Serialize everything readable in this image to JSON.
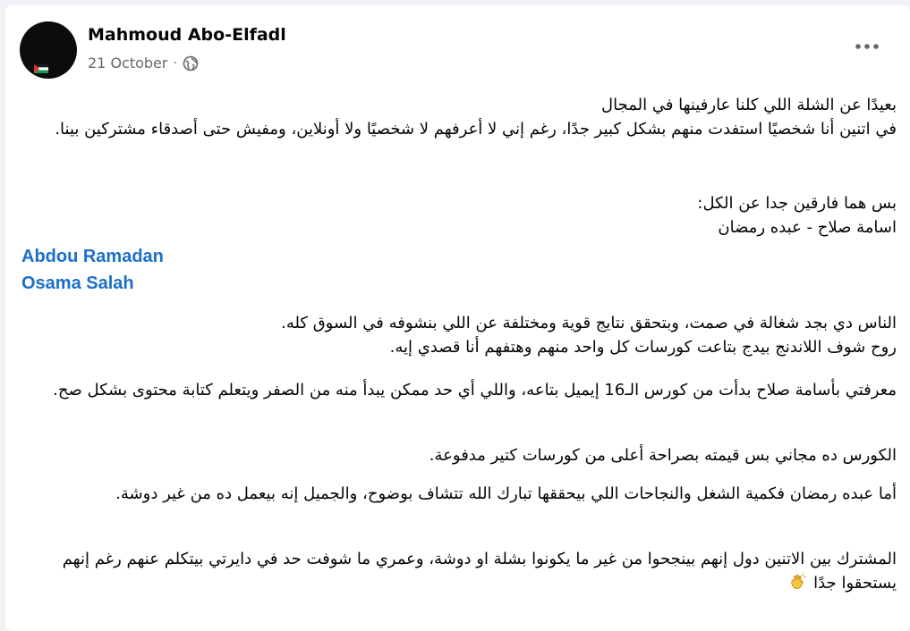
{
  "post": {
    "author": "Mahmoud Abo-Elfadl",
    "date": "21 October",
    "separator": "·",
    "icons": {
      "privacy": "globe-icon",
      "menu": "more-options-icon",
      "emoji": "clapping-hands-icon"
    },
    "colors": {
      "link": "#1b6fc9",
      "text": "#050505",
      "meta": "#65676b"
    },
    "paragraphs": [
      [
        "بعيدًا عن الشلة اللي كلنا عارفينها في المجال",
        "في اتنين أنا شخصيًا استفدت منهم بشكل كبير جدًا، رغم إني لا أعرفهم لا شخصيًا ولا أونلاين، ومفيش حتى أصدقاء مشتركين بينا."
      ],
      [
        "بس هما فارقين جدا عن الكل:",
        "اسامة صلاح - عبده رمضان"
      ]
    ],
    "mentions": [
      "Abdou Ramadan",
      "Osama Salah"
    ],
    "paragraphs_after": [
      [
        "الناس دي بجد شغالة في صمت، وبتحقق نتايج قوية ومختلفة عن اللي بنشوفه في السوق كله.",
        "روح شوف اللاندنج بيدج بتاعت كورسات كل واحد منهم وهتفهم أنا قصدي إيه."
      ],
      [
        "معرفتي بأسامة صلاح بدأت من كورس الـ16 إيميل بتاعه، واللي أي حد ممكن يبدأ منه من الصفر ويتعلم كتابة محتوى بشكل صح."
      ],
      [
        "الكورس ده مجاني بس قيمته بصراحة أعلى من كورسات كتير مدفوعة."
      ],
      [
        "أما عبده رمضان فكمية الشغل والنجاحات اللي بيحققها تبارك الله تتشاف بوضوح، والجميل إنه بيعمل ده من غير دوشة."
      ],
      [
        "المشترك بين الاتنين دول إنهم بينجحوا من غير ما يكونوا بشلة او  دوشة، وعمري ما شوفت حد في دايرتي بيتكلم عنهم رغم إنهم يستحقوا جدًا"
      ]
    ]
  }
}
